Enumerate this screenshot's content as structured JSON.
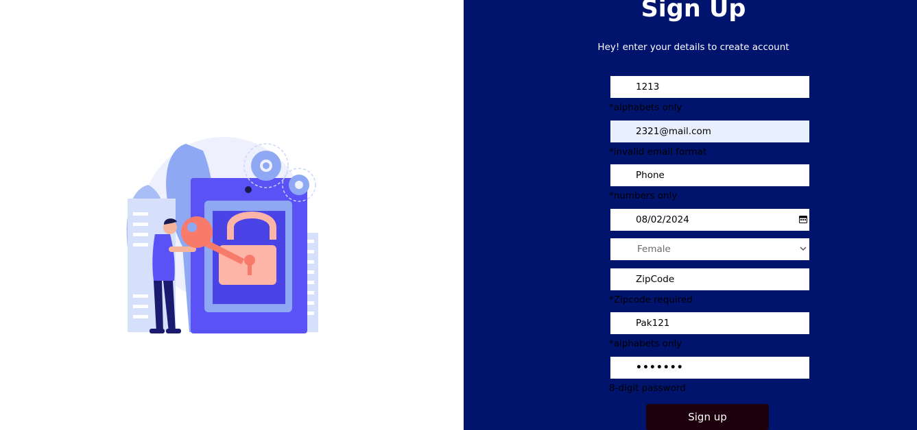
{
  "form": {
    "title": "Sign Up",
    "subtitle": "Hey! enter your details to create account",
    "name_value": "1213",
    "name_hint": "*alphabets only",
    "email_value": "2321@mail.com",
    "email_hint": "*invalid email format",
    "phone_placeholder": "Phone",
    "phone_hint": "*numbers only",
    "date_value": "08/02/2024",
    "gender_selected": "Female",
    "zip_placeholder": "ZipCode",
    "zip_hint": "*Zipcode required",
    "city_value": "Pak121",
    "city_hint": "*alphabets only",
    "password_display": "•••••••",
    "password_hint": "8-digit password",
    "submit_label": "Sign up"
  },
  "colors": {
    "panel_bg": "#00146e",
    "button_bg": "#1e000d",
    "autofill_bg": "#e8f0fe",
    "illustration_primary": "#5b52f5",
    "illustration_accent": "#f87a6a"
  },
  "icons": {
    "illustration": "person-with-key-and-padlock-illustration",
    "date_picker": "calendar-icon",
    "gender_select": "chevron-down-icon"
  }
}
